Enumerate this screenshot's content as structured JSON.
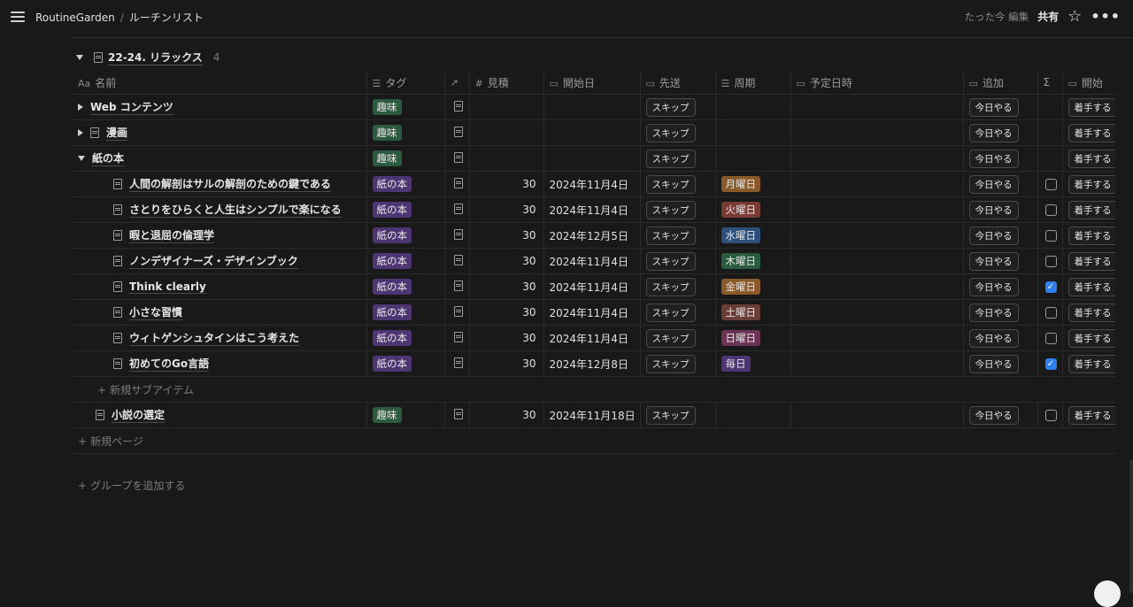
{
  "header": {
    "breadcrumb_root": "RoutineGarden",
    "breadcrumb_sep": "/",
    "breadcrumb_page": "ルーチンリスト",
    "edited": "たった今 編集",
    "share": "共有"
  },
  "group": {
    "title": "22-24. リラックス",
    "count": "4"
  },
  "columns": {
    "name": "名前",
    "tag": "タグ",
    "estimate": "見積",
    "start_date": "開始日",
    "postpone": "先送",
    "cycle": "周期",
    "scheduled": "予定日時",
    "add": "追加",
    "sum": "Σ",
    "start": "開始"
  },
  "buttons": {
    "skip": "スキップ",
    "today": "今日やる",
    "begin": "着手する"
  },
  "rows": [
    {
      "name": "Web コンテンツ",
      "tag": "趣味",
      "estimate": "",
      "date": "",
      "cycle": ""
    },
    {
      "name": "漫画",
      "tag": "趣味",
      "estimate": "",
      "date": "",
      "cycle": ""
    },
    {
      "name": "紙の本",
      "tag": "趣味",
      "estimate": "",
      "date": "",
      "cycle": ""
    },
    {
      "name": "人間の解剖はサルの解剖のための鍵である",
      "tag": "紙の本",
      "estimate": "30",
      "date": "2024年11月4日",
      "cycle": "月曜日",
      "checked": false
    },
    {
      "name": "さとりをひらくと人生はシンプルで楽になる",
      "tag": "紙の本",
      "estimate": "30",
      "date": "2024年11月4日",
      "cycle": "火曜日",
      "checked": false
    },
    {
      "name": "暇と退屈の倫理学",
      "tag": "紙の本",
      "estimate": "30",
      "date": "2024年12月5日",
      "cycle": "水曜日",
      "checked": false
    },
    {
      "name": "ノンデザイナーズ・デザインブック",
      "tag": "紙の本",
      "estimate": "30",
      "date": "2024年11月4日",
      "cycle": "木曜日",
      "checked": false
    },
    {
      "name": "Think clearly",
      "tag": "紙の本",
      "estimate": "30",
      "date": "2024年11月4日",
      "cycle": "金曜日",
      "checked": true
    },
    {
      "name": "小さな習慣",
      "tag": "紙の本",
      "estimate": "30",
      "date": "2024年11月4日",
      "cycle": "土曜日",
      "checked": false
    },
    {
      "name": "ウィトゲンシュタインはこう考えた",
      "tag": "紙の本",
      "estimate": "30",
      "date": "2024年11月4日",
      "cycle": "日曜日",
      "checked": false
    },
    {
      "name": "初めてのGo言語",
      "tag": "紙の本",
      "estimate": "30",
      "date": "2024年12月8日",
      "cycle": "毎日",
      "checked": true
    },
    {
      "name": "小説の選定",
      "tag": "趣味",
      "estimate": "30",
      "date": "2024年11月18日",
      "cycle": "",
      "checked": false
    }
  ],
  "cycle_colors": {
    "月曜日": "#8a5a2b",
    "火曜日": "#7a3b35",
    "水曜日": "#2d4f7c",
    "木曜日": "#2b5b3f",
    "金曜日": "#8a5a2b",
    "土曜日": "#6a3d36",
    "日曜日": "#6b3454",
    "毎日": "#4d3573"
  },
  "add_subitem": "新規サブアイテム",
  "add_page": "新規ページ",
  "add_group": "グループを追加する"
}
